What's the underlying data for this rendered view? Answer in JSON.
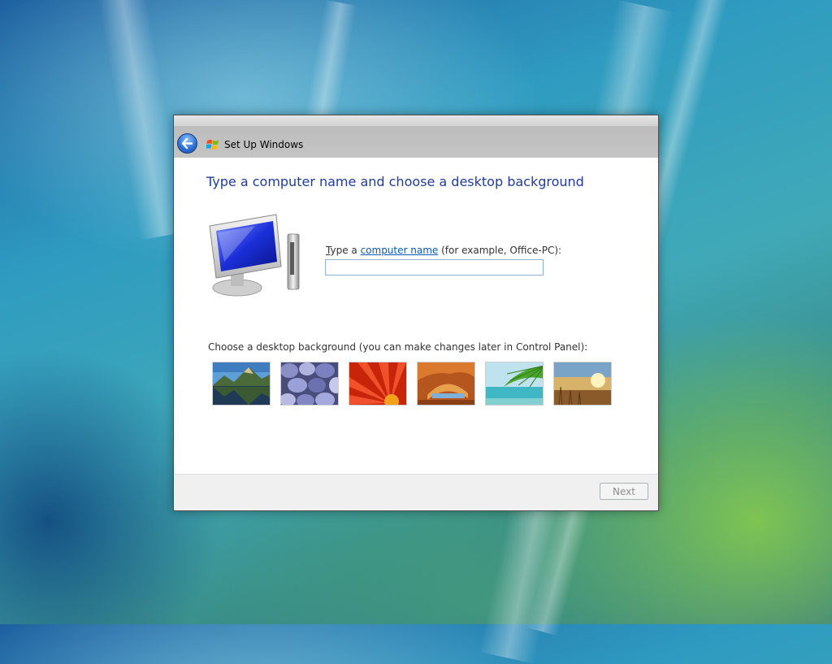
{
  "window": {
    "title": "Set Up Windows"
  },
  "page": {
    "heading": "Type a computer name and choose a desktop background"
  },
  "computer_name": {
    "label_accel": "T",
    "label_prefix": "ype a ",
    "label_link": "computer name",
    "label_suffix": " (for example, Office-PC):",
    "value": ""
  },
  "background": {
    "label": "Choose a desktop background (you can make changes later in Control Panel):",
    "thumbnails": [
      {
        "name": "mountain-lake"
      },
      {
        "name": "pebbles"
      },
      {
        "name": "red-flower"
      },
      {
        "name": "rock-arch"
      },
      {
        "name": "palm-beach"
      },
      {
        "name": "sunset-grass"
      }
    ]
  },
  "footer": {
    "next_label": "Next"
  },
  "icons": {
    "back": "back-arrow-icon",
    "windows_logo": "windows-logo-icon",
    "computer": "computer-monitor-icon"
  },
  "colors": {
    "heading": "#1f3c9b",
    "link": "#0c5ab4"
  }
}
